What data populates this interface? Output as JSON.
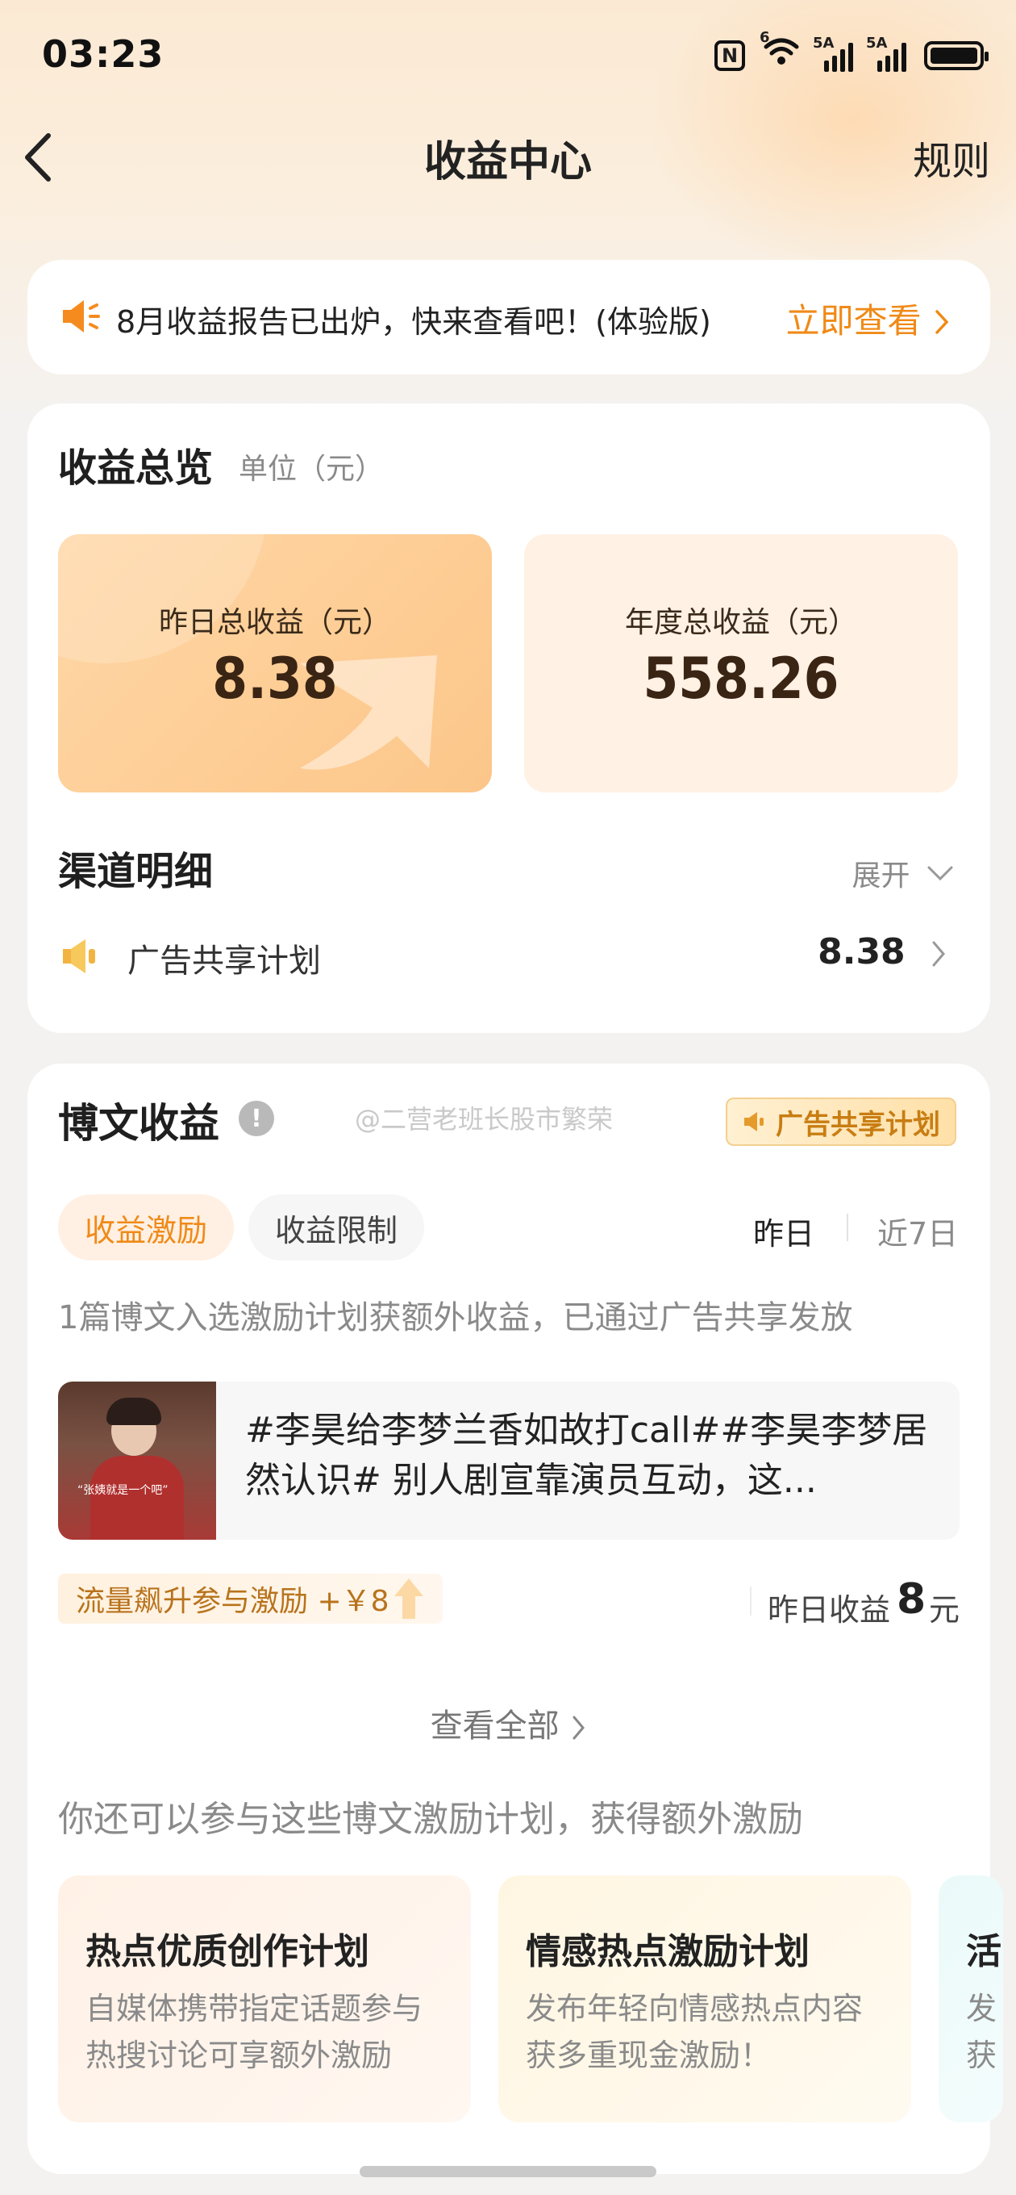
{
  "status_bar": {
    "time": "03:23",
    "wifi_label": "6",
    "sim1_label": "5A",
    "sim2_label": "5A"
  },
  "nav": {
    "title": "收益中心",
    "rules_label": "规则"
  },
  "banner": {
    "text": "8月收益报告已出炉，快来查看吧！(体验版)",
    "link_label": "立即查看"
  },
  "overview": {
    "title": "收益总览",
    "unit": "单位（元）",
    "yesterday_label": "昨日总收益（元）",
    "yesterday_value": "8.38",
    "annual_label": "年度总收益（元）",
    "annual_value": "558.26"
  },
  "channels": {
    "title": "渠道明细",
    "expand_label": "展开",
    "items": [
      {
        "label": "广告共享计划",
        "value": "8.38"
      }
    ]
  },
  "articles": {
    "title": "博文收益",
    "watermark": "@二营老班长股市繁荣",
    "badge": "广告共享计划",
    "tabs": [
      {
        "label": "收益激励",
        "active": true
      },
      {
        "label": "收益限制",
        "active": false
      }
    ],
    "range_yesterday": "昨日",
    "range_7days": "近7日",
    "description": "1篇博文入选激励计划获额外收益，已通过广告共享发放",
    "post": {
      "thumb_caption": "“张姨就是一个吧”",
      "text": "#李昊给李梦兰香如故打call##李昊李梦居然认识# 别人剧宣靠演员互动，这..."
    },
    "boost": "流量飙升参与激励 +￥8",
    "earn_label": "昨日收益",
    "earn_value": "8",
    "earn_unit": "元",
    "view_all": "查看全部",
    "more_desc": "你还可以参与这些博文激励计划，获得额外激励",
    "plans": [
      {
        "title": "热点优质创作计划",
        "desc": "自媒体携带指定话题参与热搜讨论可享额外激励"
      },
      {
        "title": "情感热点激励计划",
        "desc": "发布年轻向情感热点内容获多重现金激励！"
      },
      {
        "title": "活",
        "desc": "发获"
      }
    ]
  },
  "colors": {
    "accent": "#f08a18",
    "tile_warm": "#fcc689",
    "tile_light": "#fff1e4",
    "background": "#f4f2f0"
  }
}
